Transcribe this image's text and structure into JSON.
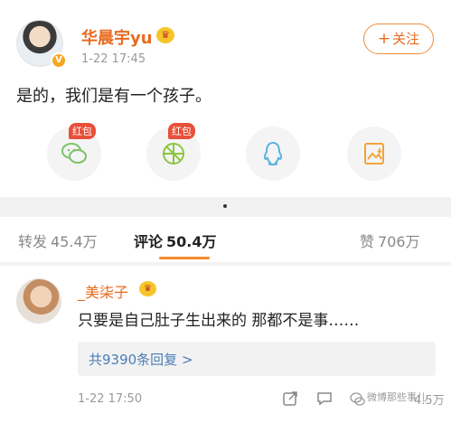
{
  "post": {
    "username": "华晨宇yu",
    "timestamp": "1-22 17:45",
    "follow_label": "关注",
    "follow_plus": "+",
    "text": "是的，我们是有一个孩子。",
    "verified_badge": "V",
    "crown_glyph": "♛"
  },
  "share": {
    "redpack_label": "红包",
    "items": [
      "wechat-icon",
      "moments-icon",
      "qq-icon",
      "save-image-icon"
    ]
  },
  "tabs": {
    "repost_label": "转发",
    "repost_count": "45.4万",
    "comment_label": "评论",
    "comment_count": "50.4万",
    "like_label": "赞",
    "like_count": "706万"
  },
  "comment": {
    "username": "_美柒子",
    "crown_glyph": "♛",
    "text": "只要是自己肚子生出来的 那都不是事……",
    "replies_label": "共9390条回复 >",
    "timestamp": "1-22 17:50",
    "watermark": "微博那些事儿",
    "like_count": "4.5万"
  },
  "colors": {
    "accent": "#e86b1f",
    "tab_underline": "#f28a2e",
    "link": "#4a7eb5",
    "redpack": "#e8503a"
  }
}
